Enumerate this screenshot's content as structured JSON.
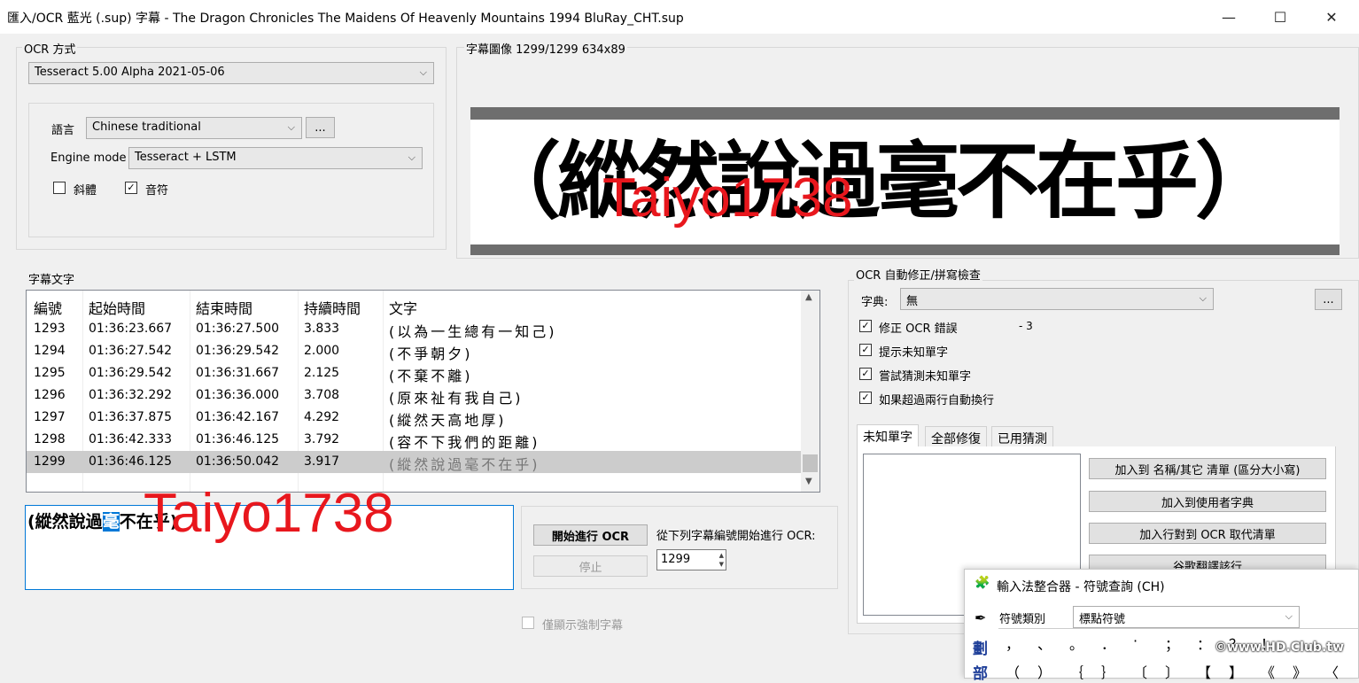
{
  "window": {
    "title": "匯入/OCR 藍光 (.sup) 字幕 - The Dragon Chronicles The Maidens Of Heavenly Mountains 1994 BluRay_CHT.sup",
    "minimize": "—",
    "maximize": "☐",
    "close": "✕"
  },
  "ocr_method": {
    "label": "OCR 方式",
    "engine": "Tesseract 5.00 Alpha 2021-05-06",
    "language_label": "語言",
    "language": "Chinese traditional",
    "more_button": "...",
    "engine_mode_label": "Engine mode",
    "engine_mode": "Tesseract + LSTM",
    "italic_label": "斜體",
    "italic_checked": false,
    "music_label": "音符",
    "music_checked": true
  },
  "subtitle_image": {
    "label": "字幕圖像 1299/1299   634x89",
    "text": "（縱然說過毫不在乎）"
  },
  "watermark": "Taiyo1738",
  "subtitle_text": {
    "label": "字幕文字",
    "columns": [
      "編號",
      "起始時間",
      "結束時間",
      "持續時間",
      "文字"
    ],
    "rows": [
      [
        "1293",
        "01:36:23.667",
        "01:36:27.500",
        "3.833",
        "(以為一生總有一知己)"
      ],
      [
        "1294",
        "01:36:27.542",
        "01:36:29.542",
        "2.000",
        "(不爭朝夕)"
      ],
      [
        "1295",
        "01:36:29.542",
        "01:36:31.667",
        "2.125",
        "(不棄不離)"
      ],
      [
        "1296",
        "01:36:32.292",
        "01:36:36.000",
        "3.708",
        "(原來祉有我自己)"
      ],
      [
        "1297",
        "01:36:37.875",
        "01:36:42.167",
        "4.292",
        "(縱然天高地厚)"
      ],
      [
        "1298",
        "01:36:42.333",
        "01:36:46.125",
        "3.792",
        "(容不下我們的距離)"
      ],
      [
        "1299",
        "01:36:46.125",
        "01:36:50.042",
        "3.917",
        "(縱然說過毫不在乎)"
      ]
    ],
    "selected_index": 6
  },
  "editor": {
    "text_before": "(縱然說過",
    "text_selected": "毫",
    "text_after": "不在乎)"
  },
  "ocr_controls": {
    "start_button": "開始進行 OCR",
    "stop_button": "停止",
    "start_from_label": "從下列字幕編號開始進行 OCR:",
    "start_from_value": "1299",
    "forced_only_label": "僅顯示強制字幕"
  },
  "autocorrect": {
    "label": "OCR 自動修正/拼寫檢查",
    "dictionary_label": "字典:",
    "dictionary_value": "無",
    "more_button": "...",
    "options": [
      {
        "label": "修正 OCR 錯誤",
        "checked": true
      },
      {
        "label": "提示未知單字",
        "checked": true
      },
      {
        "label": "嘗試猜測未知單字",
        "checked": true
      },
      {
        "label": "如果超過兩行自動換行",
        "checked": true
      }
    ],
    "fix_count": "- 3",
    "tabs": [
      "未知單字",
      "全部修復",
      "已用猜測"
    ],
    "buttons": [
      "加入到 名稱/其它 清單 (區分大小寫)",
      "加入到使用者字典",
      "加入行對到 OCR 取代清單",
      "谷歌翻譯該行"
    ]
  },
  "ime": {
    "title": "輸入法整合器 - 符號查詢 (CH)",
    "category_label": "符號類別",
    "category_value": "標點符號",
    "side_label_1": "劃",
    "side_label_2": "部",
    "symbols_row1": [
      "，",
      "、",
      "。",
      "．",
      "·",
      "；",
      "：",
      "？",
      "！"
    ],
    "symbols_row2": [
      "（",
      "）",
      "｛",
      "｝",
      "〔",
      "〕",
      "【",
      "】",
      "《",
      "》",
      "〈"
    ],
    "site_watermark": "©www.HD.Club.tw"
  }
}
